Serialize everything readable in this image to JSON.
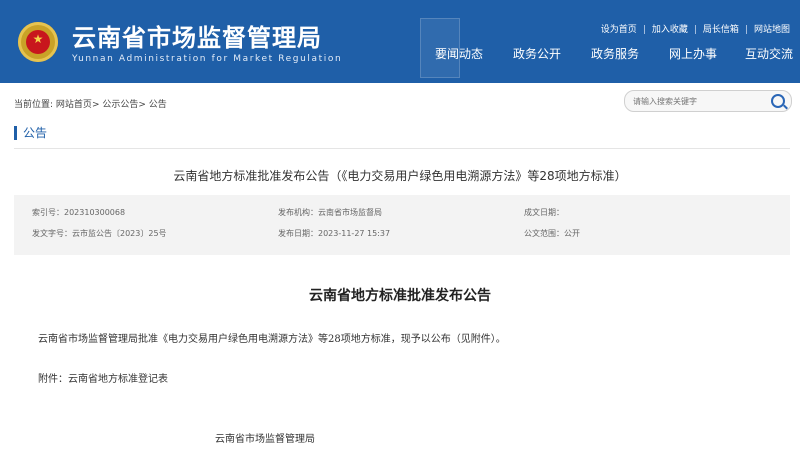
{
  "header": {
    "title_cn": "云南省市场监督管理局",
    "title_en": "Yunnan Administration for Market Regulation",
    "top_links": [
      "设为首页",
      "加入收藏",
      "局长信箱",
      "网站地图"
    ],
    "nav": [
      "要闻动态",
      "政务公开",
      "政务服务",
      "网上办事",
      "互动交流"
    ]
  },
  "breadcrumb": {
    "prefix": "当前位置:",
    "items": [
      "网站首页",
      "公示公告",
      "公告"
    ],
    "separator": ">"
  },
  "search": {
    "placeholder": "请输入搜索关键字"
  },
  "section": {
    "label": "公告"
  },
  "document": {
    "title": "云南省地方标准批准发布公告（《电力交易用户绿色用电溯源方法》等28项地方标准）",
    "meta": {
      "index_label": "索引号：",
      "index_value": "202310300068",
      "issuer_label": "发布机构：",
      "issuer_value": "云南省市场监督局",
      "date_label": "成文日期：",
      "date_value": "",
      "doc_no_label": "发文字号：",
      "doc_no_value": "云市监公告〔2023〕25号",
      "pub_date_label": "发布日期：",
      "pub_date_value": "2023-11-27 15:37",
      "scope_label": "公文范围：",
      "scope_value": "公开"
    },
    "heading": "云南省地方标准批准发布公告",
    "body": "云南省市场监督管理局批准《电力交易用户绿色用电溯源方法》等28项地方标准，现予以公布（见附件）。",
    "attachment": "附件：云南省地方标准登记表",
    "signature": "云南省市场监督管理局"
  },
  "colors": {
    "header_bg": "#1f5fa8",
    "accent": "#1f5fa8",
    "info_bg": "#f3f3f3"
  }
}
